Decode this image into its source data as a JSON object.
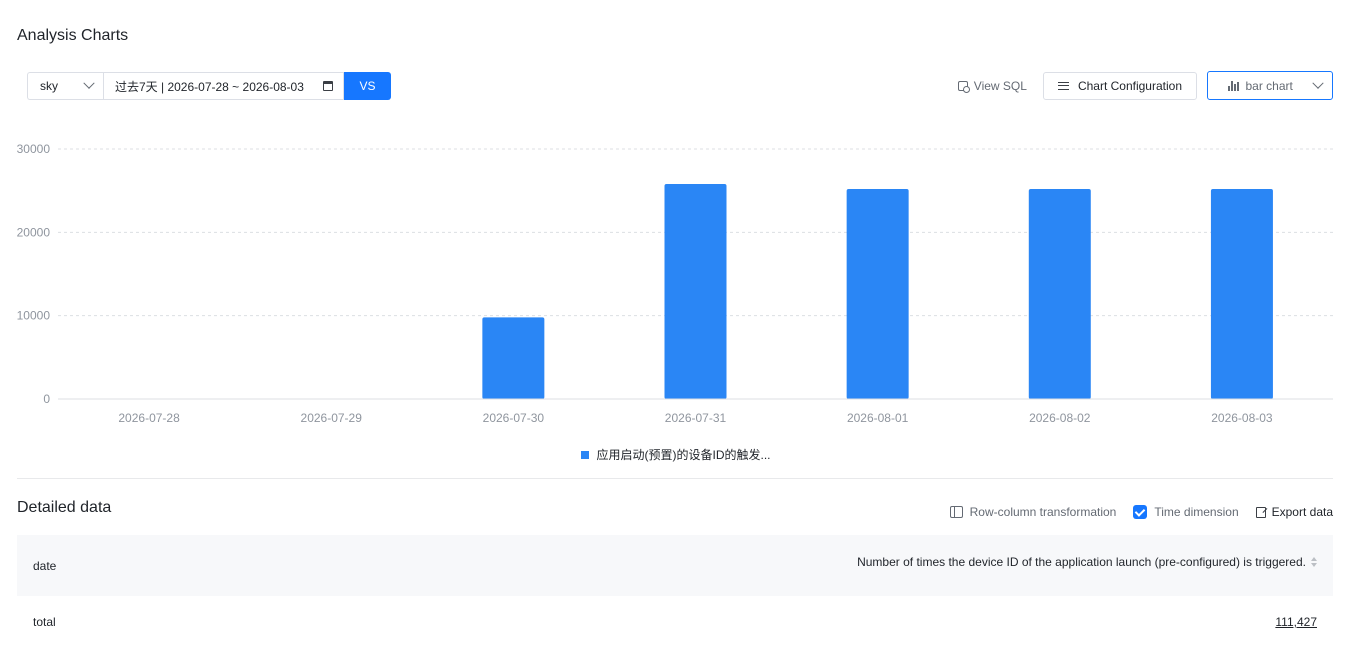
{
  "header": {
    "title": "Analysis Charts"
  },
  "toolbar": {
    "project_select": "sky",
    "date_range": "过去7天 | 2026-07-28 ~ 2026-08-03",
    "vs_label": "VS",
    "view_sql_label": "View SQL",
    "chart_config_label": "Chart Configuration",
    "chart_type_label": "bar chart"
  },
  "colors": {
    "accent": "#1677ff",
    "bar": "#2a86f5"
  },
  "chart_data": {
    "type": "bar",
    "categories": [
      "2026-07-28",
      "2026-07-29",
      "2026-07-30",
      "2026-07-31",
      "2026-08-01",
      "2026-08-02",
      "2026-08-03"
    ],
    "series": [
      {
        "name": "应用启动(预置)的设备ID的触发...",
        "values": [
          0,
          0,
          9800,
          25800,
          25200,
          25200,
          25200
        ]
      }
    ],
    "yticks": [
      "0",
      "10000",
      "20000",
      "30000"
    ],
    "ylim": [
      0,
      30000
    ],
    "grid": true,
    "legend": "bottom-center"
  },
  "detail": {
    "title": "Detailed data",
    "row_col_label": "Row-column transformation",
    "time_dimension_label": "Time dimension",
    "export_label": "Export data",
    "table": {
      "col_date": "date",
      "col_metric": "Number of times the device ID of the application launch (pre-configured) is triggered.",
      "rows": [
        {
          "date": "total",
          "value": "111,427"
        }
      ]
    }
  }
}
